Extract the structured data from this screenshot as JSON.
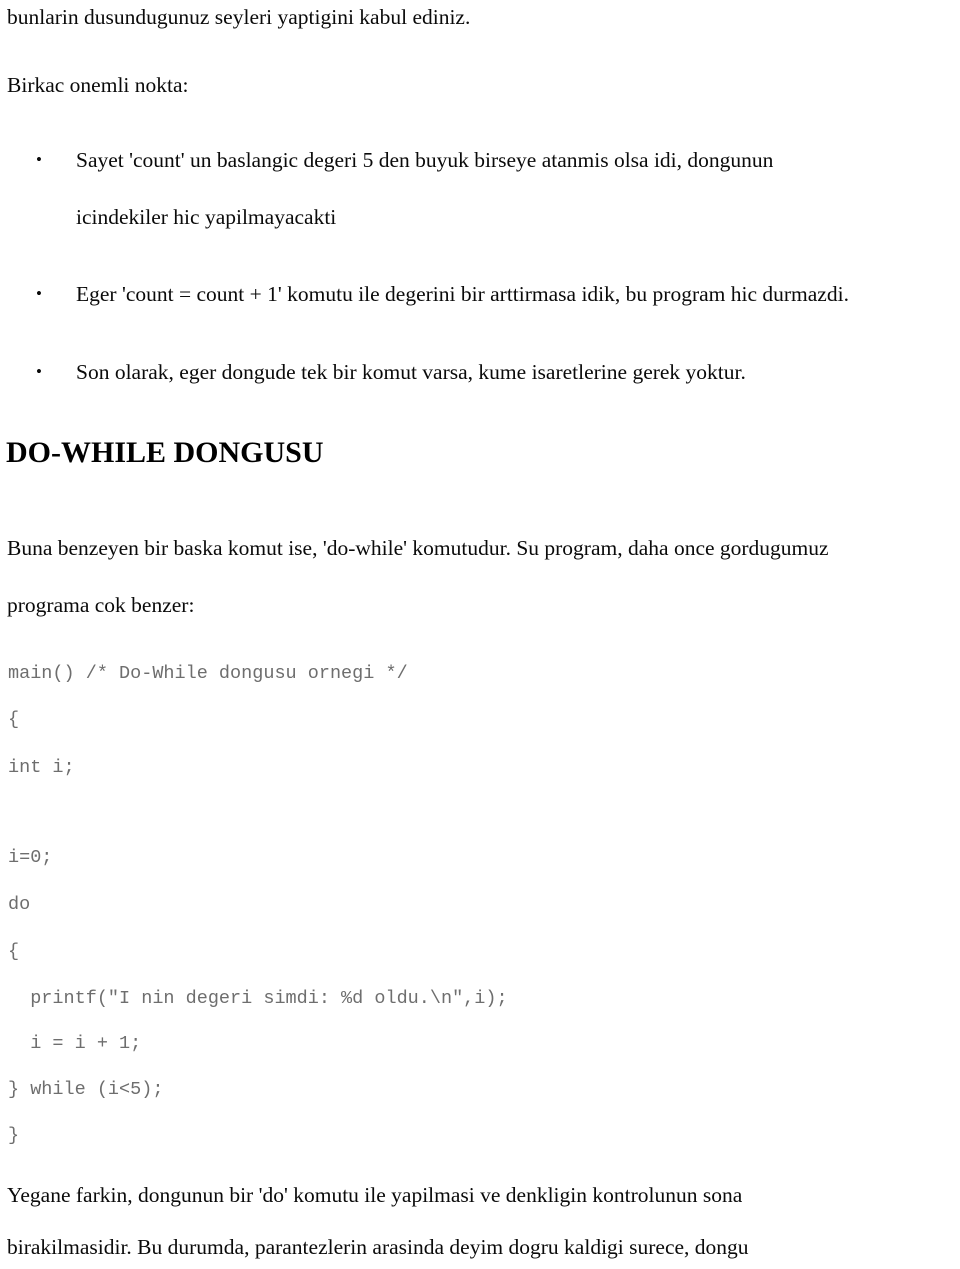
{
  "document": {
    "language": "tr",
    "topic": "DO-WHILE DONGUSU",
    "text_color": "#0a0a0a",
    "code_color": "#6e6e6e",
    "background": "#ffffff"
  },
  "intro": {
    "continuation_line": "bunlarin dusundugunuz seyleri yaptigini kabul ediniz.",
    "lead_in": "Birkac onemli nokta:"
  },
  "bullets": [
    {
      "marker": "•",
      "lines": [
        "Sayet 'count' un baslangic degeri 5 den buyuk birseye atanmis olsa idi, dongunun",
        "icindekiler hic yapilmayacakti"
      ]
    },
    {
      "marker": "•",
      "lines": [
        "Eger 'count = count + 1' komutu ile degerini bir arttirmasa idik, bu program hic durmazdi."
      ]
    },
    {
      "marker": "•",
      "lines": [
        "Son olarak, eger dongude tek bir komut varsa, kume isaretlerine gerek yoktur."
      ]
    }
  ],
  "section": {
    "heading": "DO-WHILE DONGUSU",
    "paragraph_lines": [
      "Buna benzeyen bir baska komut ise, 'do-while' komutudur. Su program, daha once gordugumuz",
      "programa cok benzer:"
    ]
  },
  "code": {
    "language": "c",
    "lines": [
      "main() /* Do-While dongusu ornegi */",
      "{",
      "int i;",
      "",
      "i=0;",
      "do",
      "{",
      "  printf(\"I nin degeri simdi: %d oldu.\\n\",i);",
      "  i = i + 1;",
      "} while (i<5);",
      "}"
    ]
  },
  "closing": {
    "paragraph_lines": [
      "Yegane farkin, dongunun bir 'do' komutu ile yapilmasi ve denkligin kontrolunun sona",
      "birakilmasidir. Bu durumda, parantezlerin arasinda deyim dogru kaldigi surece, dongu"
    ]
  }
}
